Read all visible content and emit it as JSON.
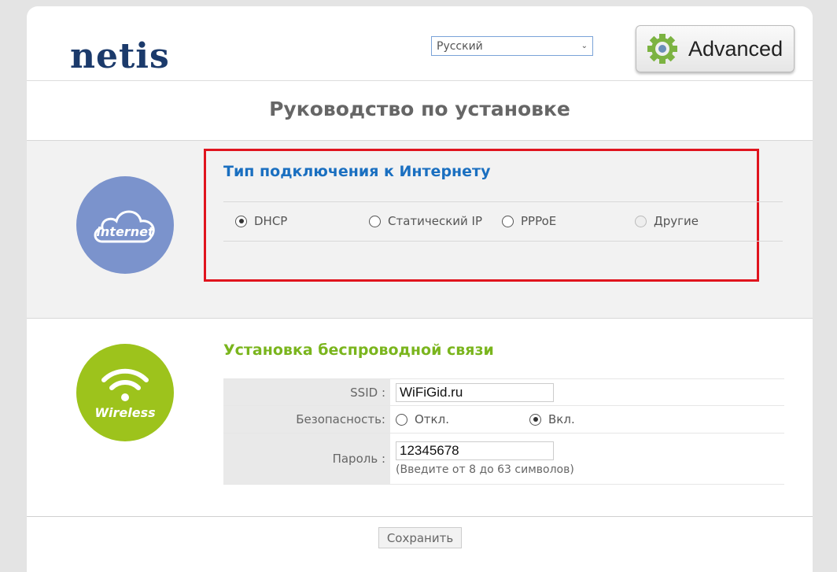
{
  "header": {
    "logo": "netis",
    "language": "Русский",
    "advanced_label": "Advanced"
  },
  "page_title": "Руководство по установке",
  "internet": {
    "icon_label": "internet",
    "title": "Тип подключения к Интернету",
    "options": [
      {
        "label": "DHCP",
        "selected": true
      },
      {
        "label": "Статический IP",
        "selected": false
      },
      {
        "label": "PPPoE",
        "selected": false
      },
      {
        "label": "Другие",
        "selected": false,
        "disabled": true
      }
    ]
  },
  "wireless": {
    "icon_label": "Wireless",
    "title": "Установка беспроводной связи",
    "ssid_label": "SSID :",
    "ssid_value": "WiFiGid.ru",
    "security_label": "Безопасность:",
    "security_off": "Откл.",
    "security_on": "Вкл.",
    "password_label": "Пароль :",
    "password_value": "12345678",
    "password_hint": "(Введите от 8 до 63 символов)"
  },
  "save_label": "Сохранить",
  "colors": {
    "highlight": "#e0141e",
    "internet_blue": "#1a6fc0",
    "wireless_green": "#7ab51d"
  }
}
